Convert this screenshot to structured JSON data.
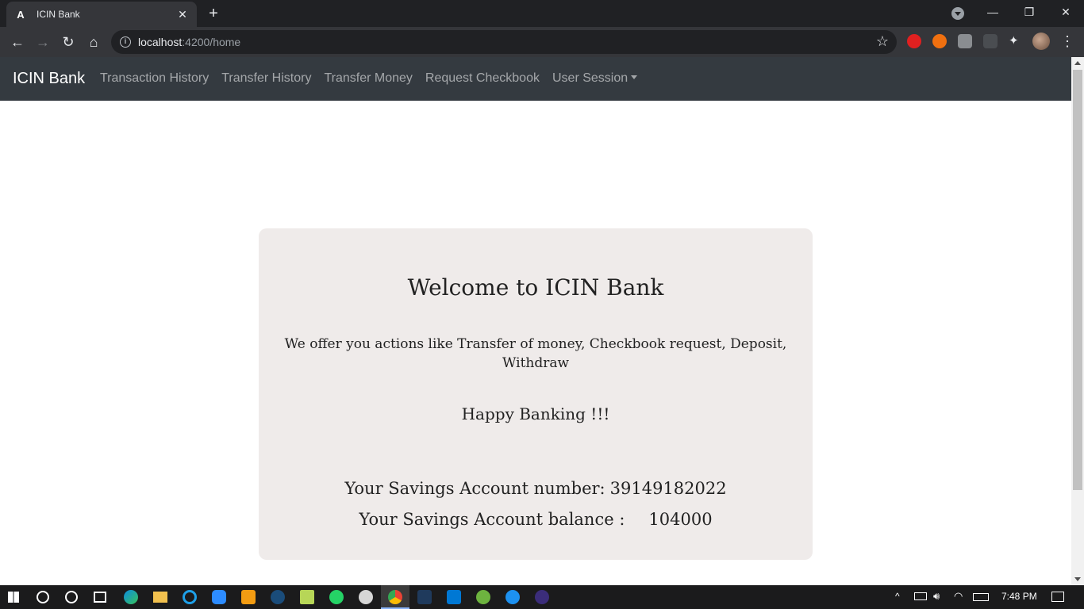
{
  "browser": {
    "tab_title": "ICIN Bank",
    "tab_favicon": "A",
    "url_host": "localhost",
    "url_rest": ":4200/home"
  },
  "navbar": {
    "brand": "ICIN Bank",
    "links": [
      "Transaction History",
      "Transfer History",
      "Transfer Money",
      "Request Checkbook",
      "User Session"
    ]
  },
  "card": {
    "heading": "Welcome to ICIN Bank",
    "offer": "We offer you actions like Transfer of money, Checkbook request, Deposit, Withdraw",
    "happy": "Happy Banking !!!",
    "account_number_label": "Your Savings Account number:",
    "account_number": "39149182022",
    "account_balance_label": "Your Savings Account balance :",
    "account_balance": "104000"
  },
  "taskbar": {
    "time": "7:48 PM"
  },
  "colors": {
    "navbar_bg": "#343a40",
    "card_bg": "#efebea"
  }
}
